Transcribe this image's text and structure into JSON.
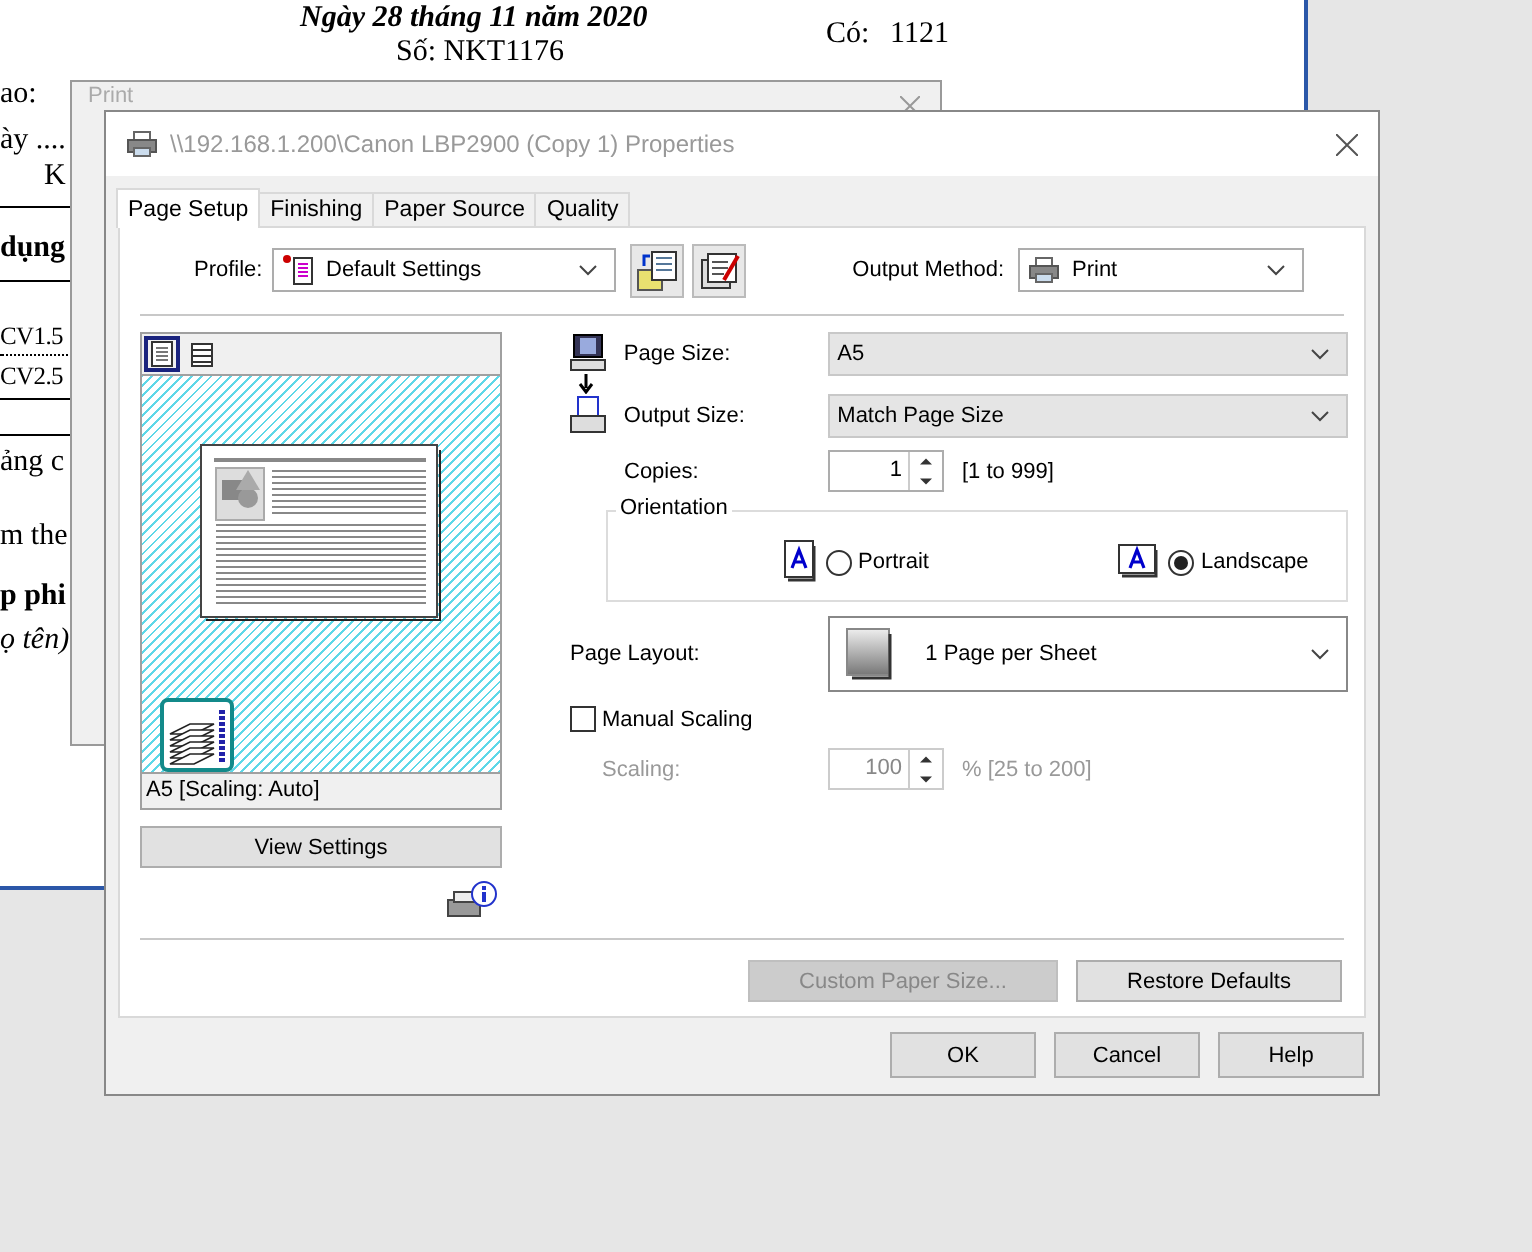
{
  "document": {
    "lines": [
      {
        "text": "Ngày 28 tháng 11 năm 2020",
        "kind": "bold_italic"
      },
      {
        "text": "Số: NKT1176",
        "kind": "plain"
      },
      {
        "text": "Có:",
        "kind": "plain"
      },
      {
        "text": "1121",
        "kind": "plain"
      },
      {
        "text": "ao:",
        "kind": "plain"
      },
      {
        "text": "ày ....",
        "kind": "plain"
      },
      {
        "text": "K",
        "kind": "plain"
      },
      {
        "text": "dụng",
        "kind": "bold"
      },
      {
        "text": "CV1.5",
        "kind": "plain"
      },
      {
        "text": "CV2.5",
        "kind": "plain"
      },
      {
        "text": "ảng c",
        "kind": "plain"
      },
      {
        "text": "m the",
        "kind": "plain"
      },
      {
        "text": "p phi",
        "kind": "bold"
      },
      {
        "text": "ọ tên)",
        "kind": "italic"
      }
    ]
  },
  "print_dialog": {
    "title": "Print"
  },
  "dialog": {
    "title": "\\\\192.168.1.200\\Canon LBP2900 (Copy 1) Properties",
    "tabs": [
      {
        "label": "Page Setup",
        "selected": true
      },
      {
        "label": "Finishing",
        "selected": false
      },
      {
        "label": "Paper Source",
        "selected": false
      },
      {
        "label": "Quality",
        "selected": false
      }
    ],
    "profile": {
      "label": "Profile:",
      "value": "Default Settings"
    },
    "output_method": {
      "label": "Output Method:",
      "value": "Print"
    },
    "preview": {
      "view_buttons": [
        {
          "selected": true
        },
        {
          "selected": false
        }
      ],
      "caption": "A5 [Scaling: Auto]",
      "button": "View Settings"
    },
    "page_size": {
      "label": "Page Size:",
      "value": "A5"
    },
    "output_size": {
      "label": "Output Size:",
      "value": "Match Page Size"
    },
    "copies": {
      "label": "Copies:",
      "value": "1",
      "range": "[1 to 999]"
    },
    "orientation": {
      "title": "Orientation",
      "options": [
        {
          "label": "Portrait",
          "selected": false
        },
        {
          "label": "Landscape",
          "selected": true
        }
      ]
    },
    "page_layout": {
      "label": "Page Layout:",
      "value": "1 Page per Sheet"
    },
    "manual_scaling": {
      "label": "Manual Scaling",
      "checked": false
    },
    "scaling": {
      "label": "Scaling:",
      "value": "100",
      "range": "% [25 to 200]",
      "disabled": true
    },
    "panel_buttons": [
      {
        "label": "Custom Paper Size...",
        "disabled": true
      },
      {
        "label": "Restore Defaults",
        "disabled": false
      }
    ],
    "footer_buttons": [
      {
        "label": "OK"
      },
      {
        "label": "Cancel"
      },
      {
        "label": "Help"
      }
    ]
  }
}
